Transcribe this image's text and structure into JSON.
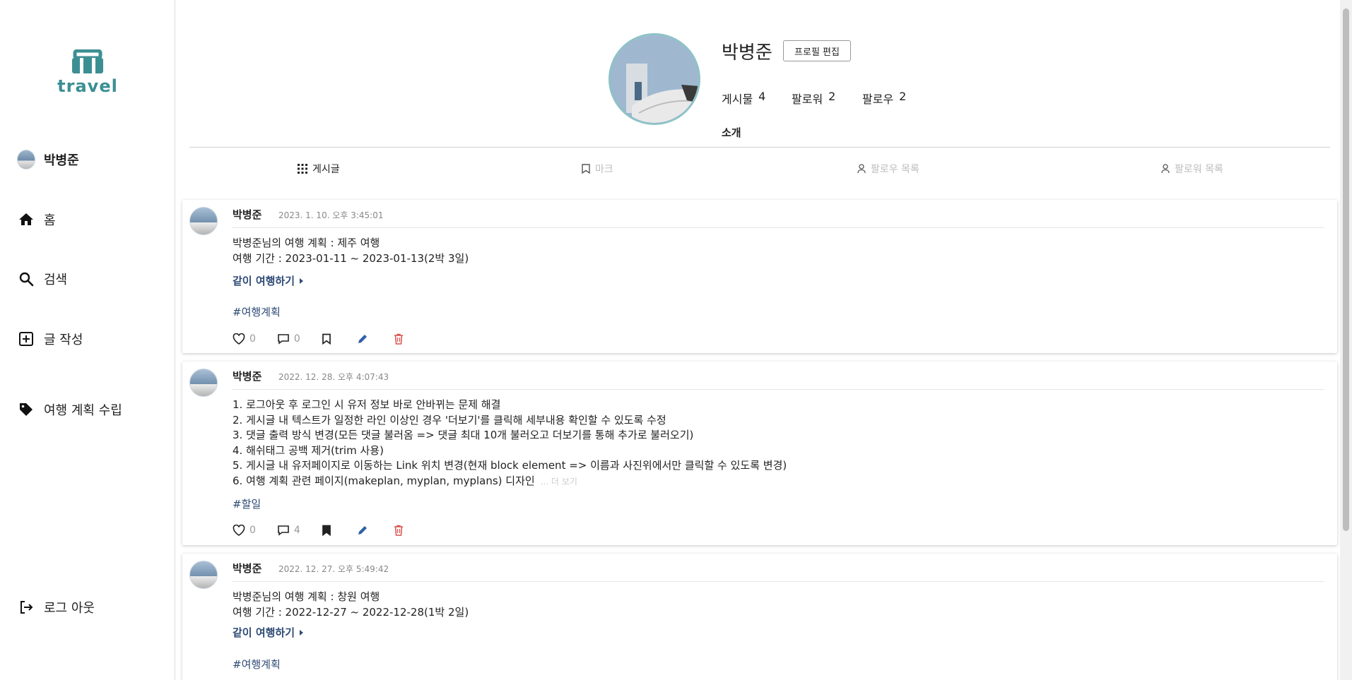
{
  "sidebar": {
    "logo_text": "travel",
    "profile_name": "박병준",
    "home": "홈",
    "search": "검색",
    "write": "글 작성",
    "plan": "여행 계획 수립",
    "logout": "로그 아웃"
  },
  "profile": {
    "name": "박병준",
    "edit_label": "프로필 편집",
    "posts_label": "게시물",
    "posts_count": "4",
    "followers_label": "팔로워",
    "followers_count": "2",
    "following_label": "팔로우",
    "following_count": "2",
    "intro_label": "소개"
  },
  "tabs": {
    "posts": "게시글",
    "mark": "마크",
    "following_list": "팔로우 목록",
    "followers_list": "팔로워 목록"
  },
  "posts": [
    {
      "author": "박병준",
      "date": "2023. 1. 10. 오후 3:45:01",
      "body": "박병준님의 여행 계획 : 제주 여행\n여행 기간 : 2023-01-11 ~ 2023-01-13(2박 3일)",
      "together": "같이 여행하기",
      "hashtag": "#여행계획",
      "likes": "0",
      "comments": "0"
    },
    {
      "author": "박병준",
      "date": "2022. 12. 28. 오후 4:07:43",
      "body": "1. 로그아웃 후 로그인 시 유저 정보 바로 안바뀌는 문제 해결\n2. 게시글 내 텍스트가 일정한 라인 이상인 경우 '더보기'를 클릭해 세부내용 확인할 수 있도록 수정\n3. 댓글 출력 방식 변경(모든 댓글 불러옴 => 댓글 최대 10개 불러오고 더보기를 통해 추가로 불러오기)\n4. 해쉬태그 공백 제거(trim 사용)\n5. 게시글 내 유저페이지로 이동하는 Link 위치 변경(현재 block element => 이름과 사진위에서만 클릭할 수 있도록 변경)\n6. 여행 계획 관련 페이지(makeplan, myplan, myplans) 디자인",
      "more": "... 더 보기",
      "hashtag": "#할일",
      "likes": "0",
      "comments": "4"
    },
    {
      "author": "박병준",
      "date": "2022. 12. 27. 오후 5:49:42",
      "body": "박병준님의 여행 계획 : 창원 여행\n여행 기간 : 2022-12-27 ~ 2022-12-28(1박 2일)",
      "together": "같이 여행하기",
      "hashtag": "#여행계획"
    }
  ],
  "colors": {
    "accent": "#3b8f93",
    "link": "#2e4a75",
    "edit": "#2f5fa8",
    "delete": "#d9534f"
  }
}
